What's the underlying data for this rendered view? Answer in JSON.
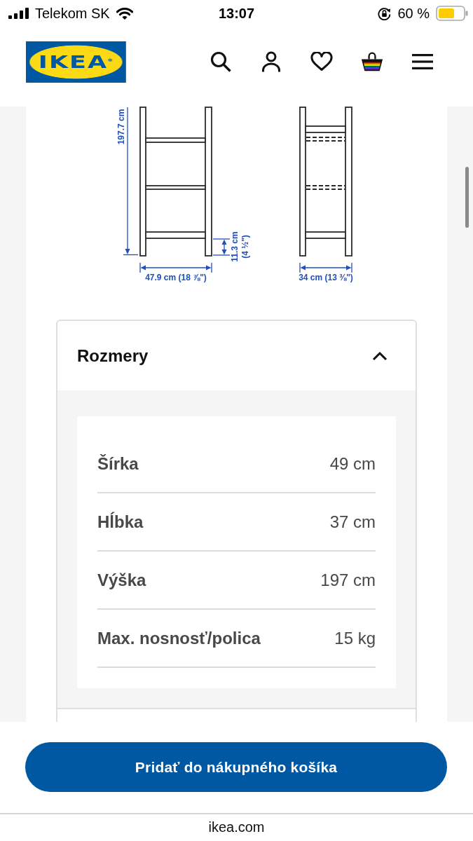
{
  "status_bar": {
    "carrier": "Telekom SK",
    "time": "13:07",
    "battery": "60 %"
  },
  "header": {
    "logo": "IKEA$^{®}$"
  },
  "drawings": [
    {
      "kind": "front",
      "height_label": "197.7 cm",
      "clearance_label": [
        "11.3 cm",
        "(4 ½\")"
      ],
      "width_label": "47.9 cm (18 ⅞\")"
    },
    {
      "kind": "side",
      "width_label": "34 cm (13 ⅜\")"
    }
  ],
  "accordion": {
    "title": "Rozmery",
    "expanded": true,
    "rows": [
      {
        "label": "Šírka",
        "value": "49 cm"
      },
      {
        "label": "Hĺbka",
        "value": "37 cm"
      },
      {
        "label": "Výška",
        "value": "197 cm"
      },
      {
        "label": "Max. nosnosť/polica",
        "value": "15 kg"
      }
    ]
  },
  "add_to_cart_button": "Pridať do nákupného košíka",
  "url_bar": {
    "address": "ikea.com"
  }
}
